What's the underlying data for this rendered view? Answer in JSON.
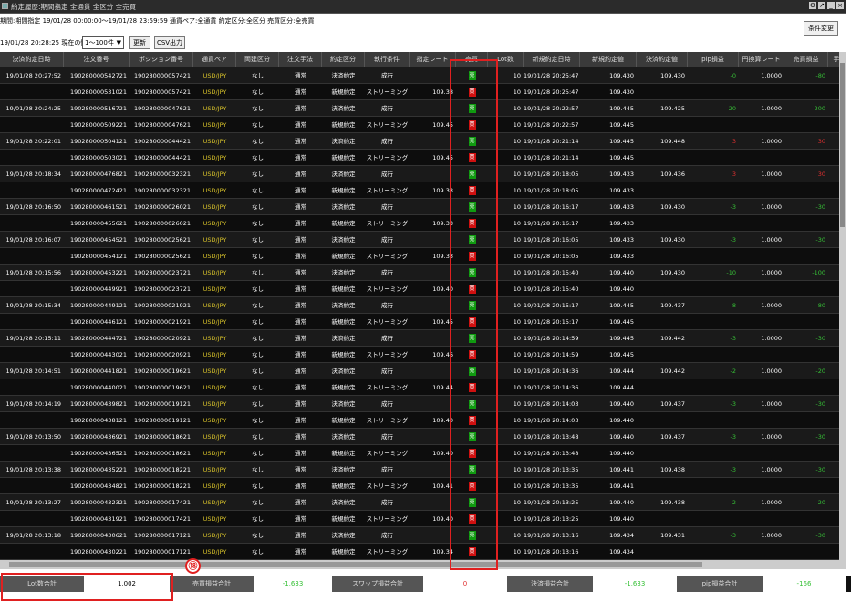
{
  "window": {
    "title": "約定履歴:期間指定 全通貨 全区分 全売買"
  },
  "conditions": "期間:期間指定 19/01/28 00:00:00～19/01/28 23:59:59 通貨ペア:全通貨 約定区分:全区分 売買区分:全売買",
  "as_of": "19/01/28 20:28:25 現在の情報",
  "buttons": {
    "change": "条件変更",
    "update": "更新",
    "csv": "CSV出力"
  },
  "range_select": {
    "value": "1～100件"
  },
  "columns": [
    "決済約定日時",
    "注文番号",
    "ポジション番号",
    "通貨ペア",
    "両建区分",
    "注文手法",
    "約定区分",
    "執行条件",
    "指定レート",
    "売買",
    "Lot数",
    "新規約定日時",
    "新規約定値",
    "決済約定値",
    "pip損益",
    "円換算レート",
    "売買損益",
    "手"
  ],
  "rows": [
    {
      "dt": "19/01/28 20:27:52",
      "order": "190280000542721",
      "position": "190280000057421",
      "pair": "USD/JPY",
      "hedge": "なし",
      "method": "通常",
      "kind": "決済約定",
      "exec": "成行",
      "rate": "",
      "side": "売",
      "lot": "10",
      "new_dt": "19/01/28 20:25:47",
      "open": "109.430",
      "close": "109.430",
      "pip": "-0",
      "conv": "1.0000",
      "pl": "-80",
      "pl_class": "pos"
    },
    {
      "dt": "",
      "order": "190280000531021",
      "position": "190280000057421",
      "pair": "USD/JPY",
      "hedge": "なし",
      "method": "通常",
      "kind": "新規約定",
      "exec": "ストリーミング",
      "rate": "109.38",
      "side": "買",
      "lot": "10",
      "new_dt": "19/01/28 20:25:47",
      "open": "109.430",
      "close": "",
      "pip": "",
      "conv": "",
      "pl": "",
      "pl_class": ""
    },
    {
      "dt": "19/01/28 20:24:25",
      "order": "190280000516721",
      "position": "190280000047621",
      "pair": "USD/JPY",
      "hedge": "なし",
      "method": "通常",
      "kind": "決済約定",
      "exec": "成行",
      "rate": "",
      "side": "売",
      "lot": "10",
      "new_dt": "19/01/28 20:22:57",
      "open": "109.445",
      "close": "109.425",
      "pip": "-20",
      "conv": "1.0000",
      "pl": "-200",
      "pl_class": "pos"
    },
    {
      "dt": "",
      "order": "190280000509221",
      "position": "190280000047621",
      "pair": "USD/JPY",
      "hedge": "なし",
      "method": "通常",
      "kind": "新規約定",
      "exec": "ストリーミング",
      "rate": "109.45",
      "side": "買",
      "lot": "10",
      "new_dt": "19/01/28 20:22:57",
      "open": "109.445",
      "close": "",
      "pip": "",
      "conv": "",
      "pl": "",
      "pl_class": ""
    },
    {
      "dt": "19/01/28 20:22:01",
      "order": "190280000504121",
      "position": "190280000044421",
      "pair": "USD/JPY",
      "hedge": "なし",
      "method": "通常",
      "kind": "決済約定",
      "exec": "成行",
      "rate": "",
      "side": "売",
      "lot": "10",
      "new_dt": "19/01/28 20:21:14",
      "open": "109.445",
      "close": "109.448",
      "pip": "3",
      "conv": "1.0000",
      "pl": "30",
      "pl_class": "neg"
    },
    {
      "dt": "",
      "order": "190280000503021",
      "position": "190280000044421",
      "pair": "USD/JPY",
      "hedge": "なし",
      "method": "通常",
      "kind": "新規約定",
      "exec": "ストリーミング",
      "rate": "109.45",
      "side": "買",
      "lot": "10",
      "new_dt": "19/01/28 20:21:14",
      "open": "109.445",
      "close": "",
      "pip": "",
      "conv": "",
      "pl": "",
      "pl_class": ""
    },
    {
      "dt": "19/01/28 20:18:34",
      "order": "190280000476821",
      "position": "190280000032321",
      "pair": "USD/JPY",
      "hedge": "なし",
      "method": "通常",
      "kind": "決済約定",
      "exec": "成行",
      "rate": "",
      "side": "売",
      "lot": "10",
      "new_dt": "19/01/28 20:18:05",
      "open": "109.433",
      "close": "109.436",
      "pip": "3",
      "conv": "1.0000",
      "pl": "30",
      "pl_class": "neg"
    },
    {
      "dt": "",
      "order": "190280000472421",
      "position": "190280000032321",
      "pair": "USD/JPY",
      "hedge": "なし",
      "method": "通常",
      "kind": "新規約定",
      "exec": "ストリーミング",
      "rate": "109.33",
      "side": "買",
      "lot": "10",
      "new_dt": "19/01/28 20:18:05",
      "open": "109.433",
      "close": "",
      "pip": "",
      "conv": "",
      "pl": "",
      "pl_class": ""
    },
    {
      "dt": "19/01/28 20:16:50",
      "order": "190280000461521",
      "position": "190280000026021",
      "pair": "USD/JPY",
      "hedge": "なし",
      "method": "通常",
      "kind": "決済約定",
      "exec": "成行",
      "rate": "",
      "side": "売",
      "lot": "10",
      "new_dt": "19/01/28 20:16:17",
      "open": "109.433",
      "close": "109.430",
      "pip": "-3",
      "conv": "1.0000",
      "pl": "-30",
      "pl_class": "pos"
    },
    {
      "dt": "",
      "order": "190280000455621",
      "position": "190280000026021",
      "pair": "USD/JPY",
      "hedge": "なし",
      "method": "通常",
      "kind": "新規約定",
      "exec": "ストリーミング",
      "rate": "109.33",
      "side": "買",
      "lot": "10",
      "new_dt": "19/01/28 20:16:17",
      "open": "109.433",
      "close": "",
      "pip": "",
      "conv": "",
      "pl": "",
      "pl_class": ""
    },
    {
      "dt": "19/01/28 20:16:07",
      "order": "190280000454521",
      "position": "190280000025621",
      "pair": "USD/JPY",
      "hedge": "なし",
      "method": "通常",
      "kind": "決済約定",
      "exec": "成行",
      "rate": "",
      "side": "売",
      "lot": "10",
      "new_dt": "19/01/28 20:16:05",
      "open": "109.433",
      "close": "109.430",
      "pip": "-3",
      "conv": "1.0000",
      "pl": "-30",
      "pl_class": "pos"
    },
    {
      "dt": "",
      "order": "190280000454121",
      "position": "190280000025621",
      "pair": "USD/JPY",
      "hedge": "なし",
      "method": "通常",
      "kind": "新規約定",
      "exec": "ストリーミング",
      "rate": "109.33",
      "side": "買",
      "lot": "10",
      "new_dt": "19/01/28 20:16:05",
      "open": "109.433",
      "close": "",
      "pip": "",
      "conv": "",
      "pl": "",
      "pl_class": ""
    },
    {
      "dt": "19/01/28 20:15:56",
      "order": "190280000453221",
      "position": "190280000023721",
      "pair": "USD/JPY",
      "hedge": "なし",
      "method": "通常",
      "kind": "決済約定",
      "exec": "成行",
      "rate": "",
      "side": "売",
      "lot": "10",
      "new_dt": "19/01/28 20:15:40",
      "open": "109.440",
      "close": "109.430",
      "pip": "-10",
      "conv": "1.0000",
      "pl": "-100",
      "pl_class": "pos"
    },
    {
      "dt": "",
      "order": "190280000449921",
      "position": "190280000023721",
      "pair": "USD/JPY",
      "hedge": "なし",
      "method": "通常",
      "kind": "新規約定",
      "exec": "ストリーミング",
      "rate": "109.40",
      "side": "買",
      "lot": "10",
      "new_dt": "19/01/28 20:15:40",
      "open": "109.440",
      "close": "",
      "pip": "",
      "conv": "",
      "pl": "",
      "pl_class": ""
    },
    {
      "dt": "19/01/28 20:15:34",
      "order": "190280000449121",
      "position": "190280000021921",
      "pair": "USD/JPY",
      "hedge": "なし",
      "method": "通常",
      "kind": "決済約定",
      "exec": "成行",
      "rate": "",
      "side": "売",
      "lot": "10",
      "new_dt": "19/01/28 20:15:17",
      "open": "109.445",
      "close": "109.437",
      "pip": "-8",
      "conv": "1.0000",
      "pl": "-80",
      "pl_class": "pos"
    },
    {
      "dt": "",
      "order": "190280000446121",
      "position": "190280000021921",
      "pair": "USD/JPY",
      "hedge": "なし",
      "method": "通常",
      "kind": "新規約定",
      "exec": "ストリーミング",
      "rate": "109.45",
      "side": "買",
      "lot": "10",
      "new_dt": "19/01/28 20:15:17",
      "open": "109.445",
      "close": "",
      "pip": "",
      "conv": "",
      "pl": "",
      "pl_class": ""
    },
    {
      "dt": "19/01/28 20:15:11",
      "order": "190280000444721",
      "position": "190280000020921",
      "pair": "USD/JPY",
      "hedge": "なし",
      "method": "通常",
      "kind": "決済約定",
      "exec": "成行",
      "rate": "",
      "side": "売",
      "lot": "10",
      "new_dt": "19/01/28 20:14:59",
      "open": "109.445",
      "close": "109.442",
      "pip": "-3",
      "conv": "1.0000",
      "pl": "-30",
      "pl_class": "pos"
    },
    {
      "dt": "",
      "order": "190280000443021",
      "position": "190280000020921",
      "pair": "USD/JPY",
      "hedge": "なし",
      "method": "通常",
      "kind": "新規約定",
      "exec": "ストリーミング",
      "rate": "109.46",
      "side": "買",
      "lot": "10",
      "new_dt": "19/01/28 20:14:59",
      "open": "109.445",
      "close": "",
      "pip": "",
      "conv": "",
      "pl": "",
      "pl_class": ""
    },
    {
      "dt": "19/01/28 20:14:51",
      "order": "190280000441821",
      "position": "190280000019621",
      "pair": "USD/JPY",
      "hedge": "なし",
      "method": "通常",
      "kind": "決済約定",
      "exec": "成行",
      "rate": "",
      "side": "売",
      "lot": "10",
      "new_dt": "19/01/28 20:14:36",
      "open": "109.444",
      "close": "109.442",
      "pip": "-2",
      "conv": "1.0000",
      "pl": "-20",
      "pl_class": "pos"
    },
    {
      "dt": "",
      "order": "190280000440021",
      "position": "190280000019621",
      "pair": "USD/JPY",
      "hedge": "なし",
      "method": "通常",
      "kind": "新規約定",
      "exec": "ストリーミング",
      "rate": "109.44",
      "side": "買",
      "lot": "10",
      "new_dt": "19/01/28 20:14:36",
      "open": "109.444",
      "close": "",
      "pip": "",
      "conv": "",
      "pl": "",
      "pl_class": ""
    },
    {
      "dt": "19/01/28 20:14:19",
      "order": "190280000439821",
      "position": "190280000019121",
      "pair": "USD/JPY",
      "hedge": "なし",
      "method": "通常",
      "kind": "決済約定",
      "exec": "成行",
      "rate": "",
      "side": "売",
      "lot": "10",
      "new_dt": "19/01/28 20:14:03",
      "open": "109.440",
      "close": "109.437",
      "pip": "-3",
      "conv": "1.0000",
      "pl": "-30",
      "pl_class": "pos"
    },
    {
      "dt": "",
      "order": "190280000438121",
      "position": "190280000019121",
      "pair": "USD/JPY",
      "hedge": "なし",
      "method": "通常",
      "kind": "新規約定",
      "exec": "ストリーミング",
      "rate": "109.40",
      "side": "買",
      "lot": "10",
      "new_dt": "19/01/28 20:14:03",
      "open": "109.440",
      "close": "",
      "pip": "",
      "conv": "",
      "pl": "",
      "pl_class": ""
    },
    {
      "dt": "19/01/28 20:13:50",
      "order": "190280000436921",
      "position": "190280000018621",
      "pair": "USD/JPY",
      "hedge": "なし",
      "method": "通常",
      "kind": "決済約定",
      "exec": "成行",
      "rate": "",
      "side": "売",
      "lot": "10",
      "new_dt": "19/01/28 20:13:48",
      "open": "109.440",
      "close": "109.437",
      "pip": "-3",
      "conv": "1.0000",
      "pl": "-30",
      "pl_class": "pos"
    },
    {
      "dt": "",
      "order": "190280000436521",
      "position": "190280000018621",
      "pair": "USD/JPY",
      "hedge": "なし",
      "method": "通常",
      "kind": "新規約定",
      "exec": "ストリーミング",
      "rate": "109.40",
      "side": "買",
      "lot": "10",
      "new_dt": "19/01/28 20:13:48",
      "open": "109.440",
      "close": "",
      "pip": "",
      "conv": "",
      "pl": "",
      "pl_class": ""
    },
    {
      "dt": "19/01/28 20:13:38",
      "order": "190280000435221",
      "position": "190280000018221",
      "pair": "USD/JPY",
      "hedge": "なし",
      "method": "通常",
      "kind": "決済約定",
      "exec": "成行",
      "rate": "",
      "side": "売",
      "lot": "10",
      "new_dt": "19/01/28 20:13:35",
      "open": "109.441",
      "close": "109.438",
      "pip": "-3",
      "conv": "1.0000",
      "pl": "-30",
      "pl_class": "pos"
    },
    {
      "dt": "",
      "order": "190280000434821",
      "position": "190280000018221",
      "pair": "USD/JPY",
      "hedge": "なし",
      "method": "通常",
      "kind": "新規約定",
      "exec": "ストリーミング",
      "rate": "109.41",
      "side": "買",
      "lot": "10",
      "new_dt": "19/01/28 20:13:35",
      "open": "109.441",
      "close": "",
      "pip": "",
      "conv": "",
      "pl": "",
      "pl_class": ""
    },
    {
      "dt": "19/01/28 20:13:27",
      "order": "190280000432321",
      "position": "190280000017421",
      "pair": "USD/JPY",
      "hedge": "なし",
      "method": "通常",
      "kind": "決済約定",
      "exec": "成行",
      "rate": "",
      "side": "売",
      "lot": "10",
      "new_dt": "19/01/28 20:13:25",
      "open": "109.440",
      "close": "109.438",
      "pip": "-2",
      "conv": "1.0000",
      "pl": "-20",
      "pl_class": "pos"
    },
    {
      "dt": "",
      "order": "190280000431921",
      "position": "190280000017421",
      "pair": "USD/JPY",
      "hedge": "なし",
      "method": "通常",
      "kind": "新規約定",
      "exec": "ストリーミング",
      "rate": "109.40",
      "side": "買",
      "lot": "10",
      "new_dt": "19/01/28 20:13:25",
      "open": "109.440",
      "close": "",
      "pip": "",
      "conv": "",
      "pl": "",
      "pl_class": ""
    },
    {
      "dt": "19/01/28 20:13:18",
      "order": "190280000430621",
      "position": "190280000017121",
      "pair": "USD/JPY",
      "hedge": "なし",
      "method": "通常",
      "kind": "決済約定",
      "exec": "成行",
      "rate": "",
      "side": "売",
      "lot": "10",
      "new_dt": "19/01/28 20:13:16",
      "open": "109.434",
      "close": "109.431",
      "pip": "-3",
      "conv": "1.0000",
      "pl": "-30",
      "pl_class": "pos"
    },
    {
      "dt": "",
      "order": "190280000430221",
      "position": "190280000017121",
      "pair": "USD/JPY",
      "hedge": "なし",
      "method": "通常",
      "kind": "新規約定",
      "exec": "ストリーミング",
      "rate": "109.34",
      "side": "買",
      "lot": "10",
      "new_dt": "19/01/28 20:13:16",
      "open": "109.434",
      "close": "",
      "pip": "",
      "conv": "",
      "pl": "",
      "pl_class": ""
    },
    {
      "dt": "19/01/28 20:13:04",
      "order": "190280000429421",
      "position": "190280000015921",
      "pair": "USD/JPY",
      "hedge": "なし",
      "method": "通常",
      "kind": "決済約定",
      "exec": "成行",
      "rate": "",
      "side": "売",
      "lot": "10",
      "new_dt": "19/01/28 20:13:02",
      "open": "109.434",
      "close": "109.431",
      "pip": "-3",
      "conv": "1.0000",
      "pl": "-30",
      "pl_class": "pos"
    }
  ],
  "footer": {
    "lot_label": "Lot数合計",
    "lot_value": "1,002",
    "pl_label": "売買損益合計",
    "pl_value": "-1,633",
    "swap_label": "スワップ損益合計",
    "swap_value": "0",
    "settle_label": "決済損益合計",
    "settle_value": "-1,633",
    "pip_label": "pip損益合計",
    "pip_value": "-166"
  },
  "annotation": {
    "marker": "⑱"
  },
  "colors": {
    "buy": "#d01010",
    "sell": "#109a10",
    "pair": "#d6c02a",
    "highlight": "#e02020"
  }
}
